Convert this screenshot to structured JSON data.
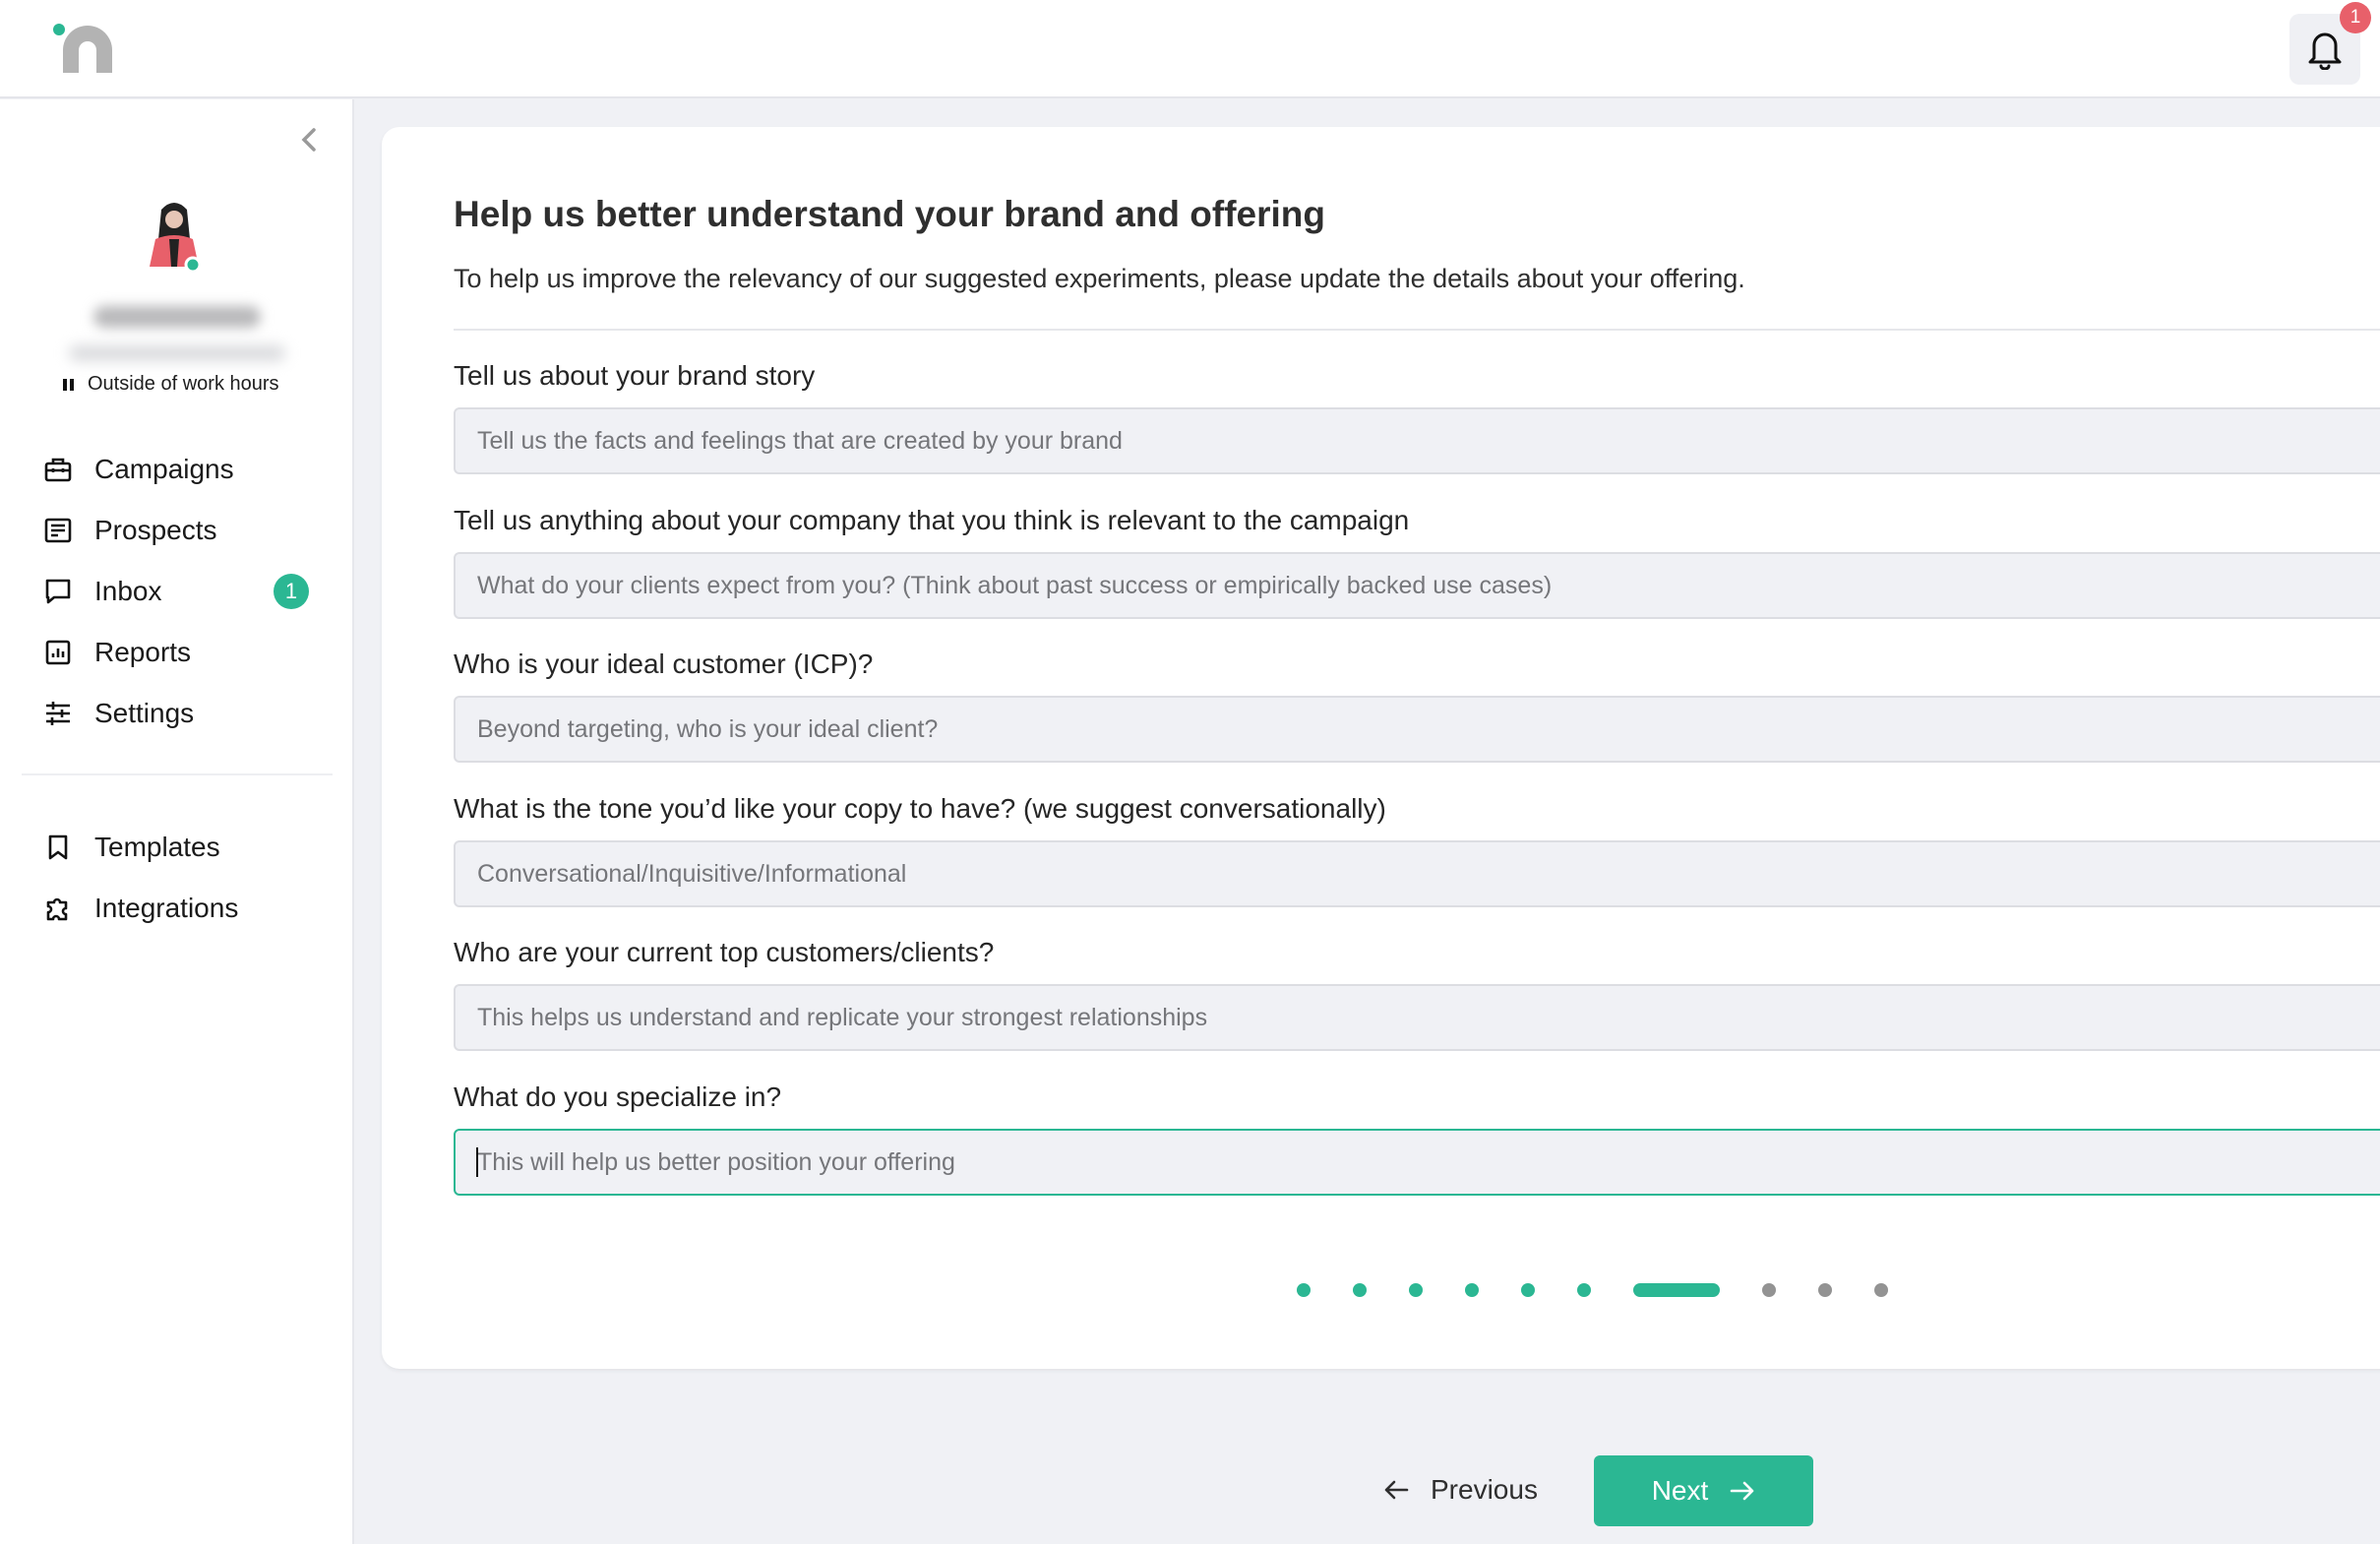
{
  "header": {
    "logo": "n-logo",
    "notifications": {
      "icon": "bell-icon",
      "count": "1"
    }
  },
  "sidebar": {
    "collapse_icon": "chevron-left-icon",
    "profile": {
      "name": "",
      "email": "",
      "status": "Outside of work hours"
    },
    "primary_items": [
      {
        "label": "Campaigns",
        "icon": "briefcase-icon"
      },
      {
        "label": "Prospects",
        "icon": "list-document-icon"
      },
      {
        "label": "Inbox",
        "icon": "chat-bubble-icon",
        "badge": "1"
      },
      {
        "label": "Reports",
        "icon": "bar-chart-icon"
      },
      {
        "label": "Settings",
        "icon": "sliders-icon"
      }
    ],
    "secondary_items": [
      {
        "label": "Templates",
        "icon": "bookmark-icon"
      },
      {
        "label": "Integrations",
        "icon": "puzzle-icon"
      }
    ]
  },
  "form": {
    "title": "Help us better understand your brand and offering",
    "subtitle": "To help us improve the relevancy of our suggested experiments, please update the details about your offering.",
    "fields": [
      {
        "label": "Tell us about your brand story",
        "value": "",
        "placeholder": "Tell us the facts and feelings that are created by your brand"
      },
      {
        "label": "Tell us anything about your company that you think is relevant to the campaign",
        "value": "",
        "placeholder": "What do your clients expect from you? (Think about past success or empirically backed use cases)"
      },
      {
        "label": "Who is your ideal customer (ICP)?",
        "value": "",
        "placeholder": "Beyond targeting, who is your ideal client?"
      },
      {
        "label": "What is the tone you’d like your copy to have? (we suggest conversationally)",
        "value": "",
        "placeholder": "Conversational/Inquisitive/Informational"
      },
      {
        "label": "Who are your current top customers/clients?",
        "value": "",
        "placeholder": "This helps us understand and replicate your strongest relationships"
      },
      {
        "label": "What do you specialize in?",
        "value": "",
        "placeholder": "This will help us better position your offering",
        "focused": true
      }
    ],
    "steps": {
      "total": 10,
      "current": 7
    }
  },
  "navigation": {
    "previous_label": "Previous",
    "next_label": "Next"
  },
  "colors": {
    "accent": "#2bb793",
    "badge_red": "#e8606a",
    "pending_dot": "#939393",
    "page_bg": "#f0f1f5"
  }
}
